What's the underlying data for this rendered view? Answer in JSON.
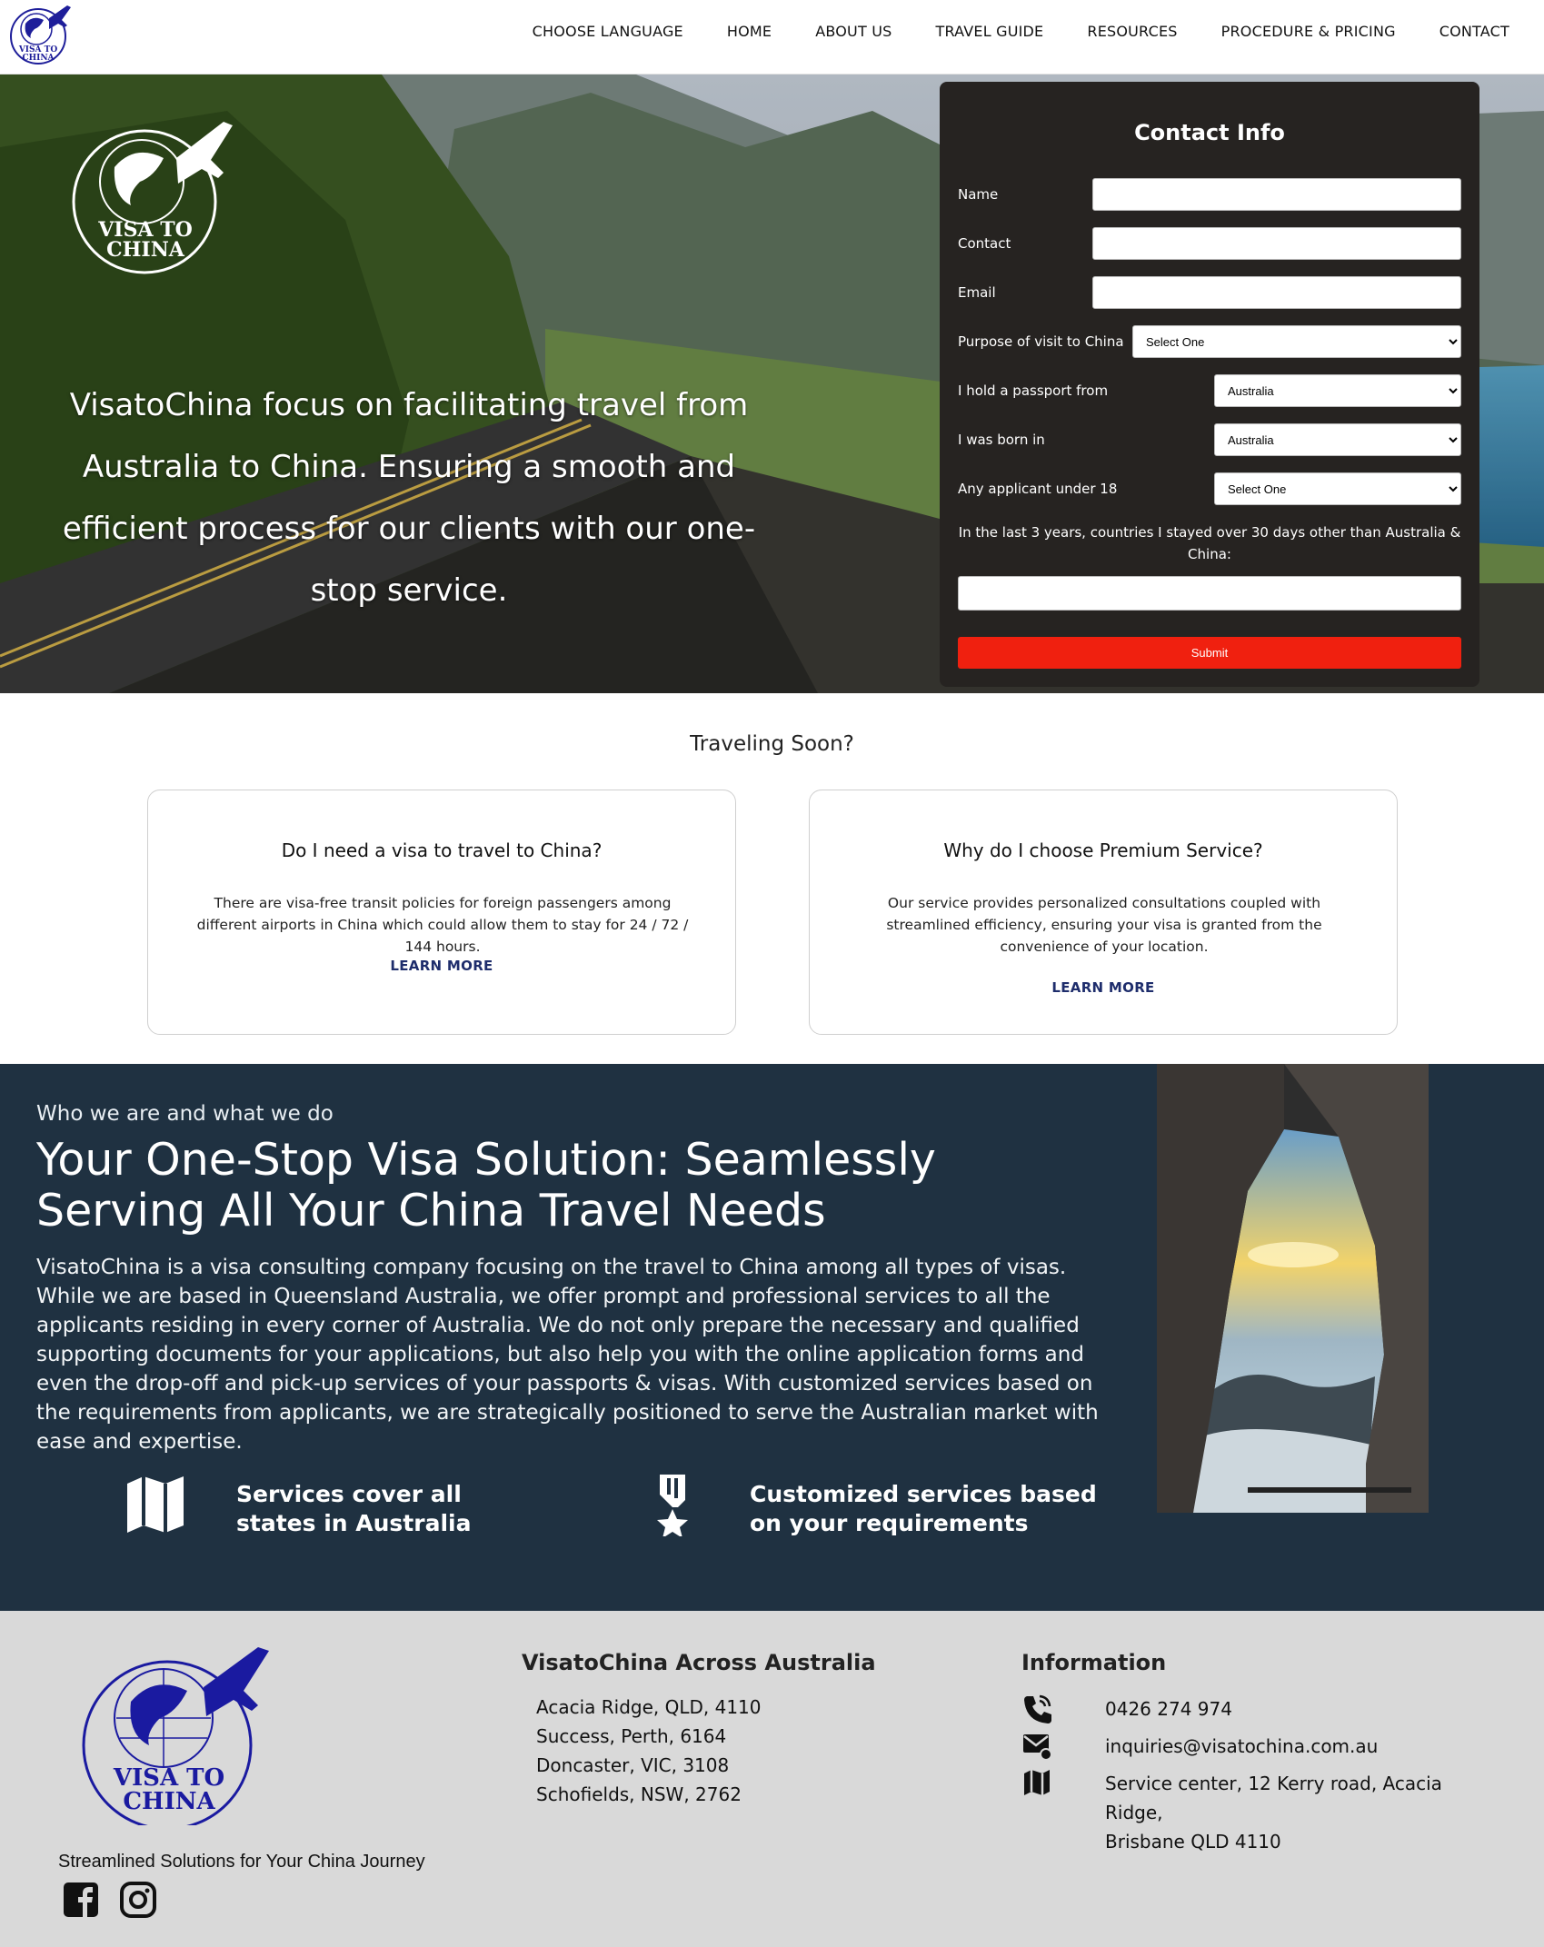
{
  "nav": {
    "items": [
      "CHOOSE LANGUAGE",
      "HOME",
      "ABOUT US",
      "TRAVEL GUIDE",
      "RESOURCES",
      "PROCEDURE & PRICING",
      "CONTACT"
    ],
    "logo_text": "VISA TO CHINA"
  },
  "hero": {
    "logo_text_line1": "VISA TO",
    "logo_text_line2": "CHINA",
    "tagline": "VisatoChina focus on facilitating travel from Australia to China. Ensuring a smooth and efficient process for our clients with our one-stop service."
  },
  "form": {
    "title": "Contact Info",
    "name_label": "Name",
    "contact_label": "Contact",
    "email_label": "Email",
    "purpose_label": "Purpose of visit to China",
    "purpose_value": "Select One",
    "passport_label": "I hold a passport from",
    "passport_value": "Australia",
    "born_label": "I was born in",
    "born_value": "Australia",
    "under18_label": "Any applicant under 18",
    "under18_value": "Select One",
    "stay_note": "In the last 3 years, countries I stayed over 30 days other than Australia & China:",
    "submit_label": "Submit",
    "submit_color": "#f0200f"
  },
  "traveling": {
    "title": "Traveling Soon?",
    "cards": [
      {
        "title": "Do I need a visa to travel to China?",
        "text": "There are visa-free transit policies for foreign passengers among different airports in China which could allow them to stay for 24 / 72 / 144 hours.",
        "link": "LEARN MORE"
      },
      {
        "title": "Why do I choose Premium Service?",
        "text": "Our service provides personalized consultations coupled with streamlined efficiency, ensuring your visa is granted from the convenience of your location.",
        "link": "LEARN MORE"
      }
    ]
  },
  "about": {
    "kicker": "Who we are and what we do",
    "heading": "Your One-Stop Visa Solution: Seamlessly Serving All Your China Travel Needs",
    "body": "VisatoChina is a visa consulting company focusing on the travel to China among all types of visas. While we are based in Queensland Australia, we offer prompt and professional services to all the applicants residing in every corner of Australia. We do not only prepare the necessary and qualified supporting documents for your applications, but also help you with the online application forms and even the drop-off and pick-up services of your passports & visas. With customized services based on the requirements from applicants, we are strategically positioned to serve the Australian market with ease and expertise.",
    "features": [
      {
        "icon": "map-icon",
        "text": "Services cover all states in Australia"
      },
      {
        "icon": "medal-icon",
        "text": "Customized services based on your requirements"
      }
    ],
    "bg_color": "#1f3141"
  },
  "footer": {
    "logo_text_line1": "VISA TO",
    "logo_text_line2": "CHINA",
    "tagline": "Streamlined Solutions for Your China Journey",
    "across_title": "VisatoChina Across Australia",
    "locations": [
      "Acacia Ridge, QLD, 4110",
      "Success, Perth, 6164",
      "Doncaster, VIC, 3108",
      "Schofields, NSW, 2762"
    ],
    "info_title": "Information",
    "phone": "0426 274 974",
    "email": "inquiries@visatochina.com.au",
    "address_line1": "Service center, 12 Kerry road, Acacia Ridge,",
    "address_line2": "Brisbane QLD 4110",
    "social": [
      "facebook-icon",
      "instagram-icon"
    ]
  }
}
